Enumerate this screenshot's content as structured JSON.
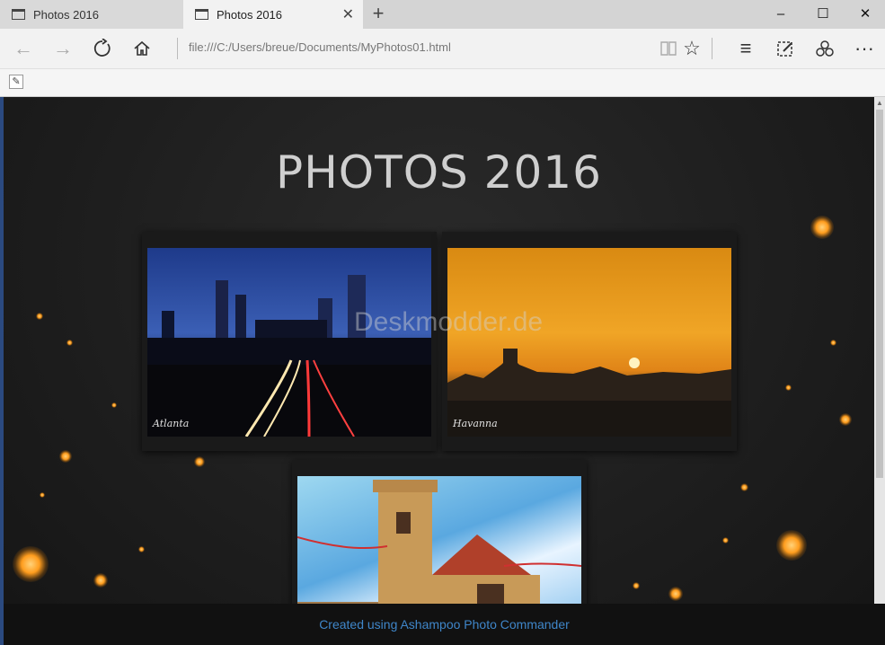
{
  "tabs": [
    {
      "title": "Photos 2016",
      "active": false
    },
    {
      "title": "Photos 2016",
      "active": true
    }
  ],
  "window": {
    "minimize": "–",
    "maximize": "☐",
    "close": "✕",
    "new_tab": "+"
  },
  "address": {
    "url": "file:///C:/Users/breue/Documents/MyPhotos01.html"
  },
  "page": {
    "title": "PHOTOS 2016",
    "photos": [
      {
        "caption": "Atlanta"
      },
      {
        "caption": "Havanna"
      },
      {
        "caption": ""
      }
    ],
    "watermark": "Deskmodder.de",
    "footer": "Created using Ashampoo Photo Commander"
  },
  "colors": {
    "accent_link": "#3f86c9",
    "background": "#1c1c1c",
    "spark": "#ff9d1e"
  }
}
